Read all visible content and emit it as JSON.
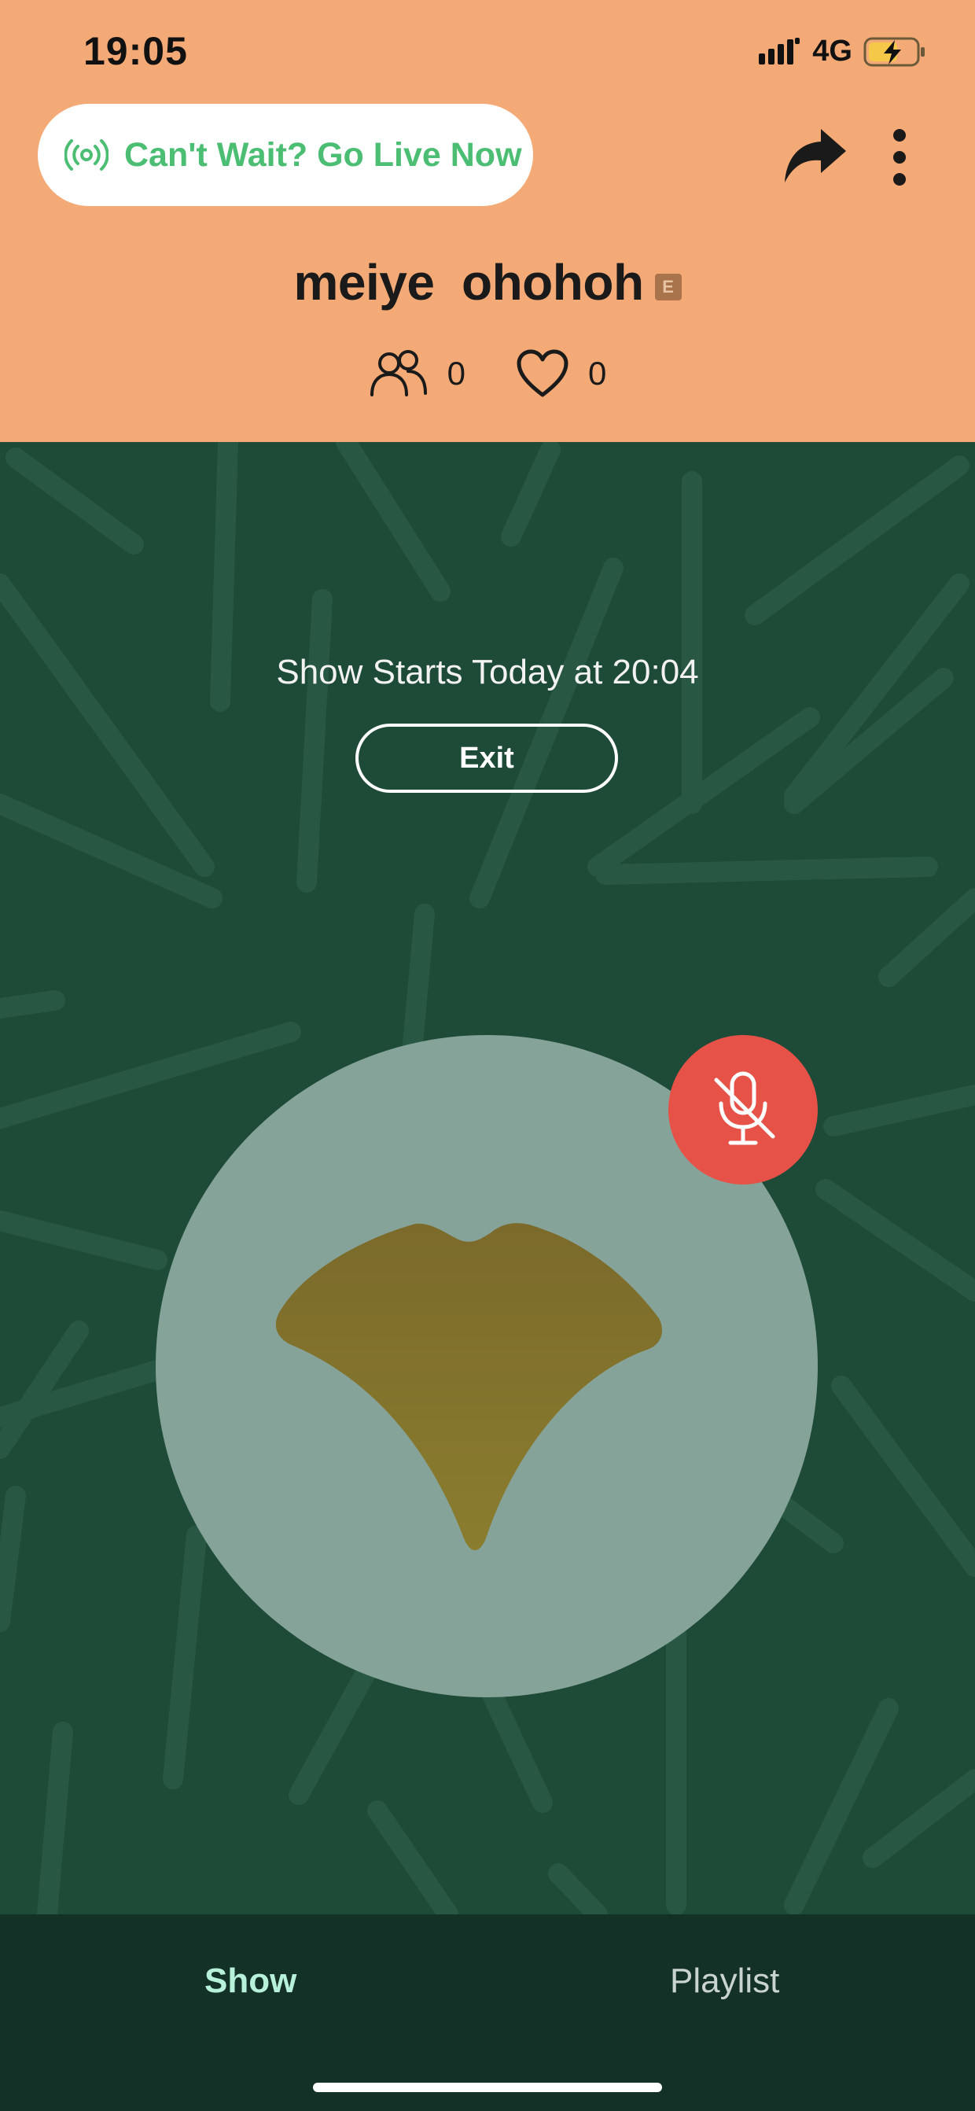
{
  "status_bar": {
    "time": "19:05",
    "network": "4G"
  },
  "header": {
    "go_live_label": "Can't Wait? Go Live Now",
    "host_name": "meiye  ohohoh",
    "explicit_badge": "E",
    "listeners_count": "0",
    "likes_count": "0"
  },
  "stage": {
    "show_start_text": "Show Starts Today at 20:04",
    "exit_label": "Exit"
  },
  "tabs": {
    "show": "Show",
    "playlist": "Playlist"
  },
  "icons": {
    "broadcast": "broadcast-icon",
    "share": "share-icon",
    "more": "more-vertical-icon",
    "listeners": "people-icon",
    "likes": "heart-icon",
    "mic_muted": "mic-off-icon",
    "avatar": "ginkgo-leaf-icon"
  },
  "colors": {
    "header_bg": "#f4aa76",
    "accent_green": "#4cbe74",
    "stage_bg": "#1e4a38",
    "mute_red": "#e65247",
    "tab_active": "#b7f1da"
  }
}
